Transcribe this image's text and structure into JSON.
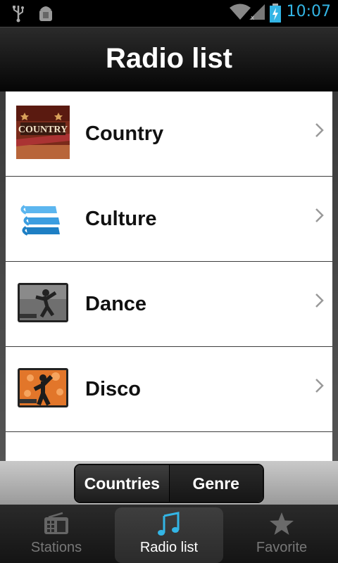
{
  "status_bar": {
    "time": "10:07",
    "icons": [
      "usb-icon",
      "android-debug-icon",
      "wifi-icon",
      "signal-icon",
      "battery-charging-icon"
    ],
    "time_color": "#33b5e5"
  },
  "header": {
    "title": "Radio list"
  },
  "list": {
    "items": [
      {
        "label": "Country",
        "icon": "country-thumb-icon"
      },
      {
        "label": "Culture",
        "icon": "books-icon"
      },
      {
        "label": "Dance",
        "icon": "dance-thumb-icon"
      },
      {
        "label": "Disco",
        "icon": "disco-thumb-icon"
      }
    ]
  },
  "segmented": {
    "options": [
      "Countries",
      "Genre"
    ],
    "selected": "Countries"
  },
  "tabs": [
    {
      "label": "Stations",
      "icon": "radio-icon",
      "selected": false
    },
    {
      "label": "Radio list",
      "icon": "music-note-icon",
      "selected": true
    },
    {
      "label": "Favorite",
      "icon": "star-icon",
      "selected": false
    }
  ],
  "colors": {
    "accent": "#33b5e5"
  }
}
